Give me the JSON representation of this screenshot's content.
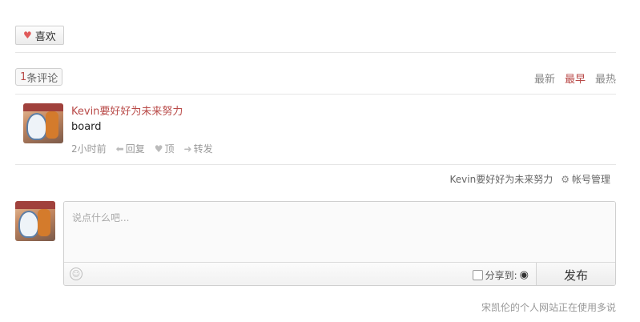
{
  "like_button": {
    "label": "喜欢",
    "icon": "heart-icon"
  },
  "comments": {
    "count_label_num": "1",
    "count_label_rest": "条评论",
    "sort_options": [
      "最新",
      "最早",
      "最热"
    ],
    "active_sort": "最早",
    "items": [
      {
        "author": "Kevin要好好为未来努力",
        "message": "board",
        "time": "2小时前",
        "reply_label": "回复",
        "up_label": "顶",
        "share_label": "转发"
      }
    ]
  },
  "account": {
    "user_name": "Kevin要好好为未来努力",
    "manage_label": "帐号管理"
  },
  "editor": {
    "placeholder": "说点什么吧...",
    "share_label": "分享到:",
    "publish_label": "发布"
  },
  "footer": {
    "text": "宋凯伦的个人网站正在使用多说"
  },
  "colors": {
    "accent": "#b94a48",
    "heart": "#e05b5b"
  }
}
